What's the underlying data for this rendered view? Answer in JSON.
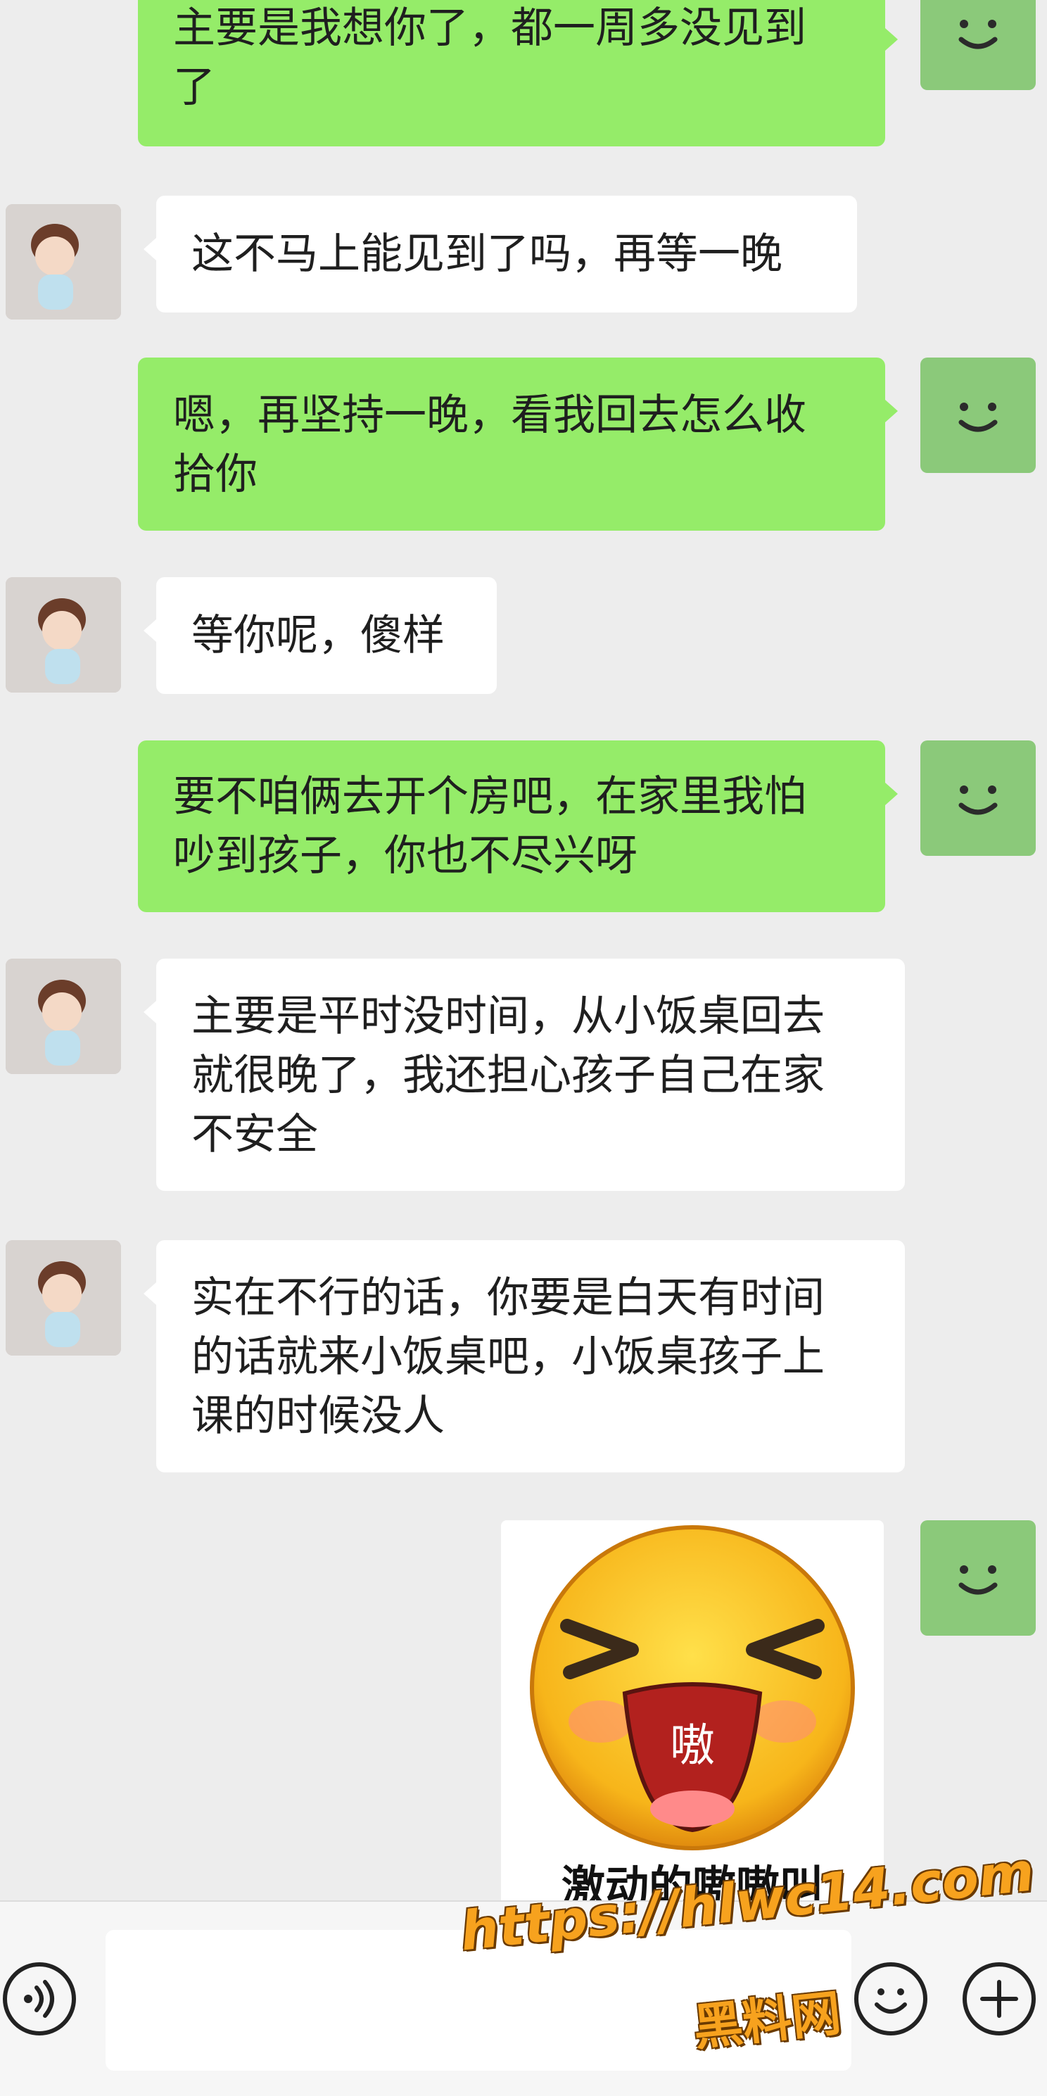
{
  "messages": [
    {
      "from": "me",
      "lines": [
        "主要是我想你了，都一周多没见到",
        "了"
      ]
    },
    {
      "from": "peer",
      "lines": [
        "这不马上能见到了吗，再等一晚"
      ]
    },
    {
      "from": "me",
      "lines": [
        "嗯，再坚持一晚，看我回去怎么收",
        "拾你"
      ]
    },
    {
      "from": "peer",
      "lines": [
        "等你呢，傻样"
      ]
    },
    {
      "from": "me",
      "lines": [
        "要不咱俩去开个房吧，在家里我怕",
        "吵到孩子，你也不尽兴呀"
      ]
    },
    {
      "from": "peer",
      "lines": [
        "主要是平时没时间，从小饭桌回去",
        "就很晚了，我还担心孩子自己在家",
        "不安全"
      ]
    },
    {
      "from": "peer",
      "lines": [
        "实在不行的话，你要是白天有时间",
        "的话就来小饭桌吧，小饭桌孩子上",
        "课的时候没人"
      ]
    }
  ],
  "sticker": {
    "mouth_text": "嗷",
    "caption": "激动的嗷嗷叫"
  },
  "colors": {
    "me_bubble": "#95ec69",
    "peer_bubble": "#ffffff",
    "background": "#ededed",
    "watermark": "#f7a21e"
  },
  "watermark": {
    "url": "https://hlwc14.com",
    "name": "黑料网"
  },
  "icons": {
    "voice": "voice-icon",
    "emoji": "emoji-icon",
    "plus": "plus-icon"
  }
}
